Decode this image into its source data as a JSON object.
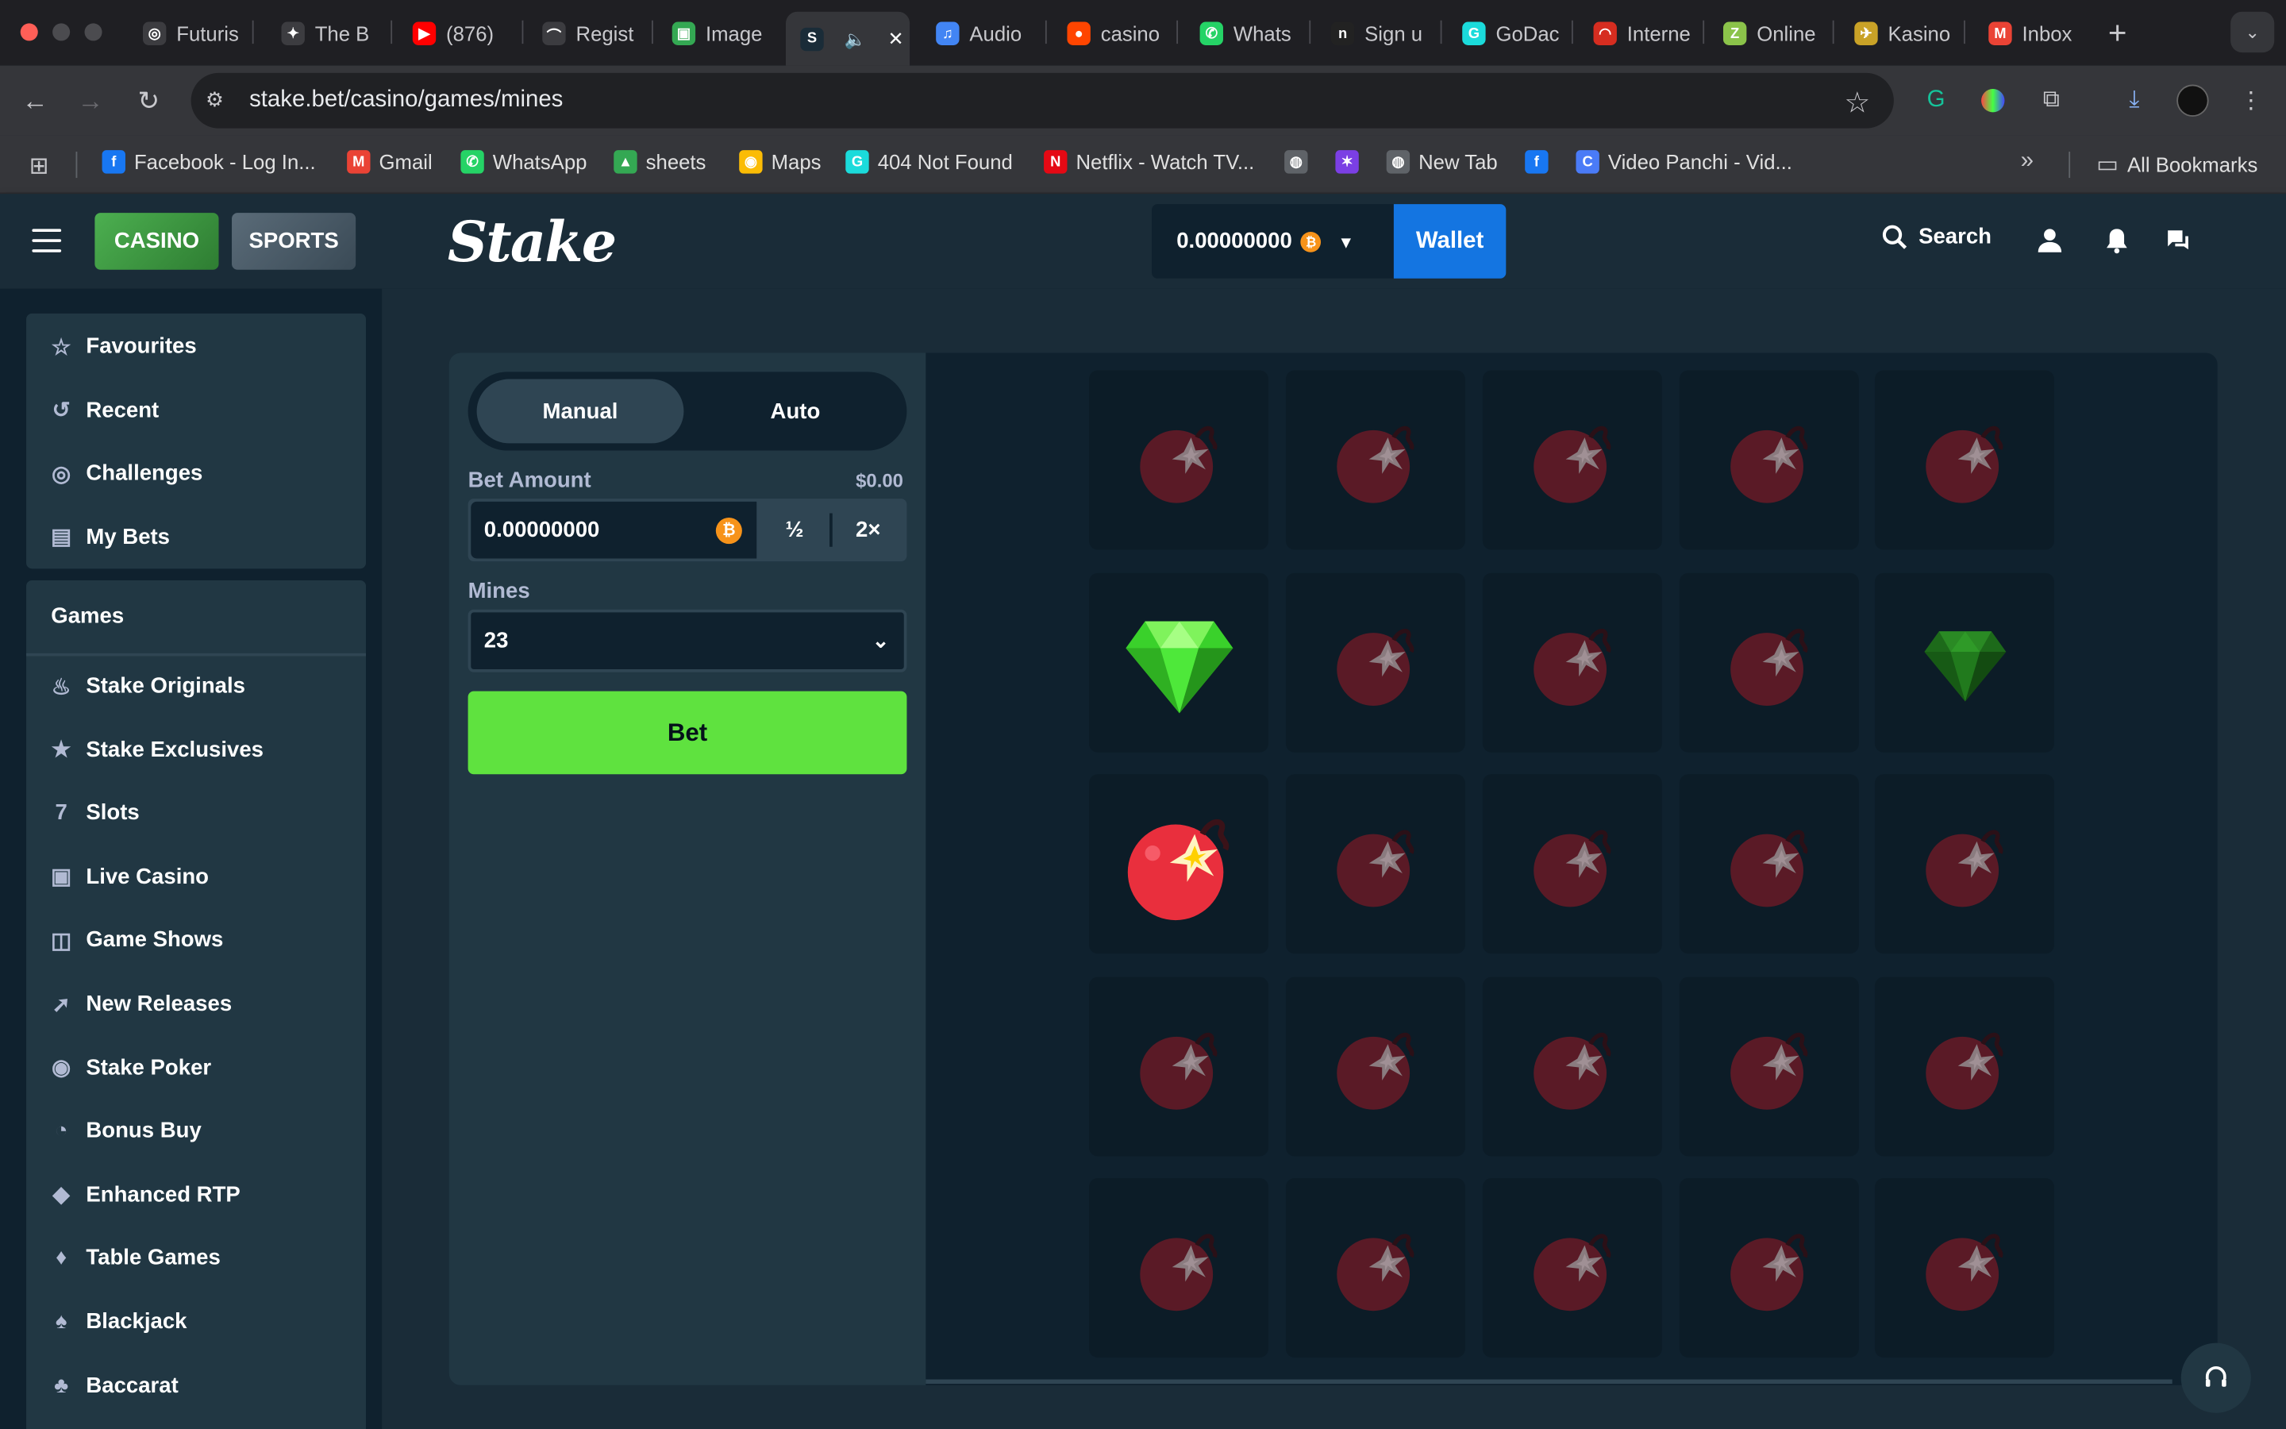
{
  "browser": {
    "tabs": [
      {
        "title": "Futuris",
        "color": "#3c3c40",
        "glyph": "◎"
      },
      {
        "title": "The B",
        "color": "#3c3c40",
        "glyph": "✦"
      },
      {
        "title": "(876)",
        "color": "#ff0000",
        "glyph": "▶"
      },
      {
        "title": "Regist",
        "color": "#3c3c40",
        "glyph": "⌒"
      },
      {
        "title": "Image",
        "color": "#34a853",
        "glyph": "▣"
      },
      {
        "title": "",
        "color": "#1a2c38",
        "glyph": "S"
      },
      {
        "title": "Audio",
        "color": "#4285f4",
        "glyph": "♫"
      },
      {
        "title": "casino",
        "color": "#ff4500",
        "glyph": "●"
      },
      {
        "title": "Whats",
        "color": "#25d366",
        "glyph": "✆"
      },
      {
        "title": "Sign u",
        "color": "#222",
        "glyph": "n"
      },
      {
        "title": "GoDac",
        "color": "#1bdbdb",
        "glyph": "G"
      },
      {
        "title": "Interne",
        "color": "#d62d20",
        "glyph": "◠"
      },
      {
        "title": "Online",
        "color": "#8bc34a",
        "glyph": "Z"
      },
      {
        "title": "Kasino",
        "color": "#c9a227",
        "glyph": "✈"
      },
      {
        "title": "Inbox",
        "color": "#ea4335",
        "glyph": "M"
      }
    ],
    "url": "stake.bet/casino/games/mines",
    "bookmarks": [
      {
        "label": "Facebook - Log In...",
        "color": "#1877f2",
        "glyph": "f"
      },
      {
        "label": "Gmail",
        "color": "#ea4335",
        "glyph": "M"
      },
      {
        "label": "WhatsApp",
        "color": "#25d366",
        "glyph": "✆"
      },
      {
        "label": "sheets",
        "color": "#34a853",
        "glyph": "▲"
      },
      {
        "label": "Maps",
        "color": "#fbbc05",
        "glyph": "◉"
      },
      {
        "label": "404 Not Found",
        "color": "#1bdbdb",
        "glyph": "G"
      },
      {
        "label": "Netflix - Watch TV...",
        "color": "#e50914",
        "glyph": "N"
      },
      {
        "label": "",
        "color": "#5f6368",
        "glyph": "◍"
      },
      {
        "label": "",
        "color": "#7b3fe4",
        "glyph": "✶"
      },
      {
        "label": "New Tab",
        "color": "#5f6368",
        "glyph": "◍"
      },
      {
        "label": "",
        "color": "#1877f2",
        "glyph": "f"
      },
      {
        "label": "Video Panchi - Vid...",
        "color": "#4a7bf7",
        "glyph": "C"
      }
    ],
    "all_bookmarks": "All Bookmarks",
    "more_bookmarks": "»"
  },
  "stake": {
    "casino_label": "CASINO",
    "sports_label": "SPORTS",
    "logo": "Stake",
    "balance": "0.00000000",
    "coin_glyph": "₿",
    "wallet_label": "Wallet",
    "search_label": "Search"
  },
  "sidebar": {
    "top_items": [
      {
        "label": "Favourites",
        "icon": "star-icon",
        "glyph": "☆"
      },
      {
        "label": "Recent",
        "icon": "history-icon",
        "glyph": "↺"
      },
      {
        "label": "Challenges",
        "icon": "challenge-icon",
        "glyph": "◎"
      },
      {
        "label": "My Bets",
        "icon": "receipt-icon",
        "glyph": "▤"
      }
    ],
    "games_header": "Games",
    "game_items": [
      {
        "label": "Stake Originals",
        "icon": "flame-icon",
        "glyph": "♨"
      },
      {
        "label": "Stake Exclusives",
        "icon": "bookmark-icon",
        "glyph": "★"
      },
      {
        "label": "Slots",
        "icon": "slots-icon",
        "glyph": "7"
      },
      {
        "label": "Live Casino",
        "icon": "live-icon",
        "glyph": "▣"
      },
      {
        "label": "Game Shows",
        "icon": "gift-icon",
        "glyph": "◫"
      },
      {
        "label": "New Releases",
        "icon": "rocket-icon",
        "glyph": "➚"
      },
      {
        "label": "Stake Poker",
        "icon": "poker-chip-icon",
        "glyph": "◉"
      },
      {
        "label": "Bonus Buy",
        "icon": "bonus-icon",
        "glyph": "◔"
      },
      {
        "label": "Enhanced RTP",
        "icon": "rtp-icon",
        "glyph": "◆"
      },
      {
        "label": "Table Games",
        "icon": "table-icon",
        "glyph": "♦"
      },
      {
        "label": "Blackjack",
        "icon": "blackjack-icon",
        "glyph": "♠"
      },
      {
        "label": "Baccarat",
        "icon": "baccarat-icon",
        "glyph": "♣"
      }
    ]
  },
  "game": {
    "manual_label": "Manual",
    "auto_label": "Auto",
    "bet_amount_label": "Bet Amount",
    "bet_amount_fiat": "$0.00",
    "bet_amount_value": "0.00000000",
    "half_label": "½",
    "double_label": "2×",
    "mines_label": "Mines",
    "mines_value": "23",
    "bet_button": "Bet",
    "grid": [
      [
        "mine",
        "mine",
        "mine",
        "mine",
        "mine"
      ],
      [
        "gem-revealed",
        "mine",
        "mine",
        "mine",
        "gem-dim"
      ],
      [
        "mine-hit",
        "mine",
        "mine",
        "mine",
        "mine"
      ],
      [
        "mine",
        "mine",
        "mine",
        "mine",
        "mine"
      ],
      [
        "mine",
        "mine",
        "mine",
        "mine",
        "mine"
      ]
    ]
  },
  "colors": {
    "green": "#5fe23f",
    "blue": "#1475e1",
    "mine_red": "#ec2c3f",
    "panel": "#213743",
    "dark": "#0f212e"
  }
}
